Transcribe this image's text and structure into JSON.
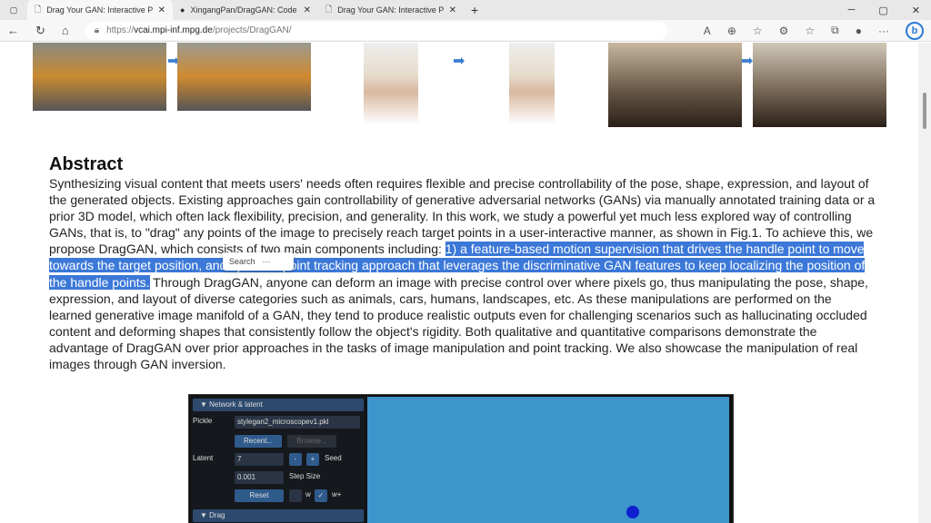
{
  "tabs": [
    {
      "title": "Drag Your GAN: Interactive Point",
      "active": true
    },
    {
      "title": "XingangPan/DragGAN: Code for",
      "active": false
    },
    {
      "title": "Drag Your GAN: Interactive Point",
      "active": false
    }
  ],
  "address": {
    "prefix": "https://",
    "domain": "vcai.mpi-inf.mpg.de",
    "path": "/projects/DragGAN/"
  },
  "abstract": {
    "heading": "Abstract",
    "before": "Synthesizing visual content that meets users' needs often requires flexible and precise controllability of the pose, shape, expression, and layout of the generated objects. Existing approaches gain controllability of generative adversarial networks (GANs) via manually annotated training data or a prior 3D model, which often lack flexibility, precision, and generality. In this work, we study a powerful yet much less explored way of controlling GANs, that is, to \"drag\" any points of the image to precisely reach target points in a user-interactive manner, as shown in Fig.1. To achieve this, we propose DragGAN, which consists of two main components including: ",
    "highlight": "1) a feature-based motion supervision that drives the handle point to move towards the target position, and 2) a new point tracking approach that leverages the discriminative GAN features to keep localizing the position of the handle points.",
    "after": " Through DragGAN, anyone can deform an image with precise control over where pixels go, thus manipulating the pose, shape, expression, and layout of diverse categories such as animals, cars, humans, landscapes, etc. As these manipulations are performed on the learned generative image manifold of a GAN, they tend to produce realistic outputs even for challenging scenarios such as hallucinating occluded content and deforming shapes that consistently follow the object's rigidity. Both qualitative and quantitative comparisons demonstrate the advantage of DragGAN over prior approaches in the tasks of image manipulation and point tracking. We also showcase the manipulation of real images through GAN inversion."
  },
  "popup": {
    "label": "Search",
    "more": "···"
  },
  "gui": {
    "network_header": "Network & latent",
    "pickle_label": "Pickle",
    "pickle_value": "stylegan2_microscopev1.pkl",
    "recent": "Recent...",
    "browse": "Browse...",
    "latent_label": "Latent",
    "latent_value": "7",
    "minus": "-",
    "plus": "+",
    "seed": "Seed",
    "step_value": "0.001",
    "step_label": "Step Size",
    "reset": "Reset",
    "w": "w",
    "wplus": "w+",
    "drag_header": "Drag"
  }
}
